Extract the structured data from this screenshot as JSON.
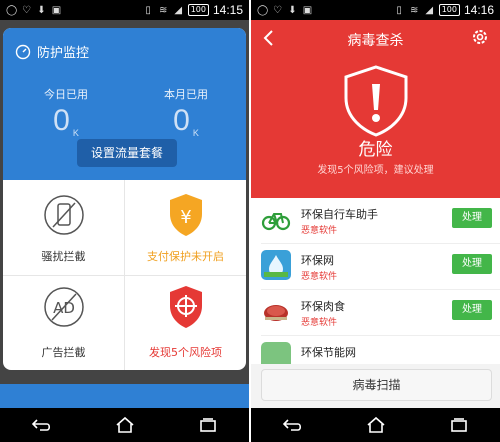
{
  "left": {
    "status": {
      "time": "14:15",
      "battery": "100"
    },
    "dialog": {
      "title": "防护监控",
      "today": {
        "label": "今日已用",
        "value": "0",
        "unit": "K"
      },
      "month": {
        "label": "本月已用",
        "value": "0",
        "unit": "K"
      },
      "setup_button": "设置流量套餐"
    },
    "features": [
      {
        "label": "骚扰拦截",
        "icon": "phone-block-icon"
      },
      {
        "label": "支付保护未开启",
        "icon": "yuan-shield-icon"
      },
      {
        "label": "广告拦截",
        "icon": "ad-block-icon"
      },
      {
        "label": "发现5个风险项",
        "icon": "crosshair-shield-icon"
      }
    ]
  },
  "right": {
    "status": {
      "time": "14:16",
      "battery": "100"
    },
    "header": {
      "title": "病毒查杀",
      "status": "危险",
      "subtitle": "发现5个风险项，建议处理"
    },
    "apps": [
      {
        "name": "环保自行车助手",
        "tag": "恶意软件",
        "action": "处理",
        "icon": "bicycle-icon"
      },
      {
        "name": "环保网",
        "tag": "恶意软件",
        "action": "处理",
        "icon": "water-drop-icon"
      },
      {
        "name": "环保肉食",
        "tag": "恶意软件",
        "action": "处理",
        "icon": "meat-icon"
      },
      {
        "name": "环保节能网",
        "tag": "",
        "action": "",
        "icon": "leaf-icon"
      }
    ],
    "scan_button": "病毒扫描"
  },
  "colors": {
    "blue": "#2f80d4",
    "red": "#e53935",
    "green": "#43b649",
    "orange": "#f0a020"
  }
}
